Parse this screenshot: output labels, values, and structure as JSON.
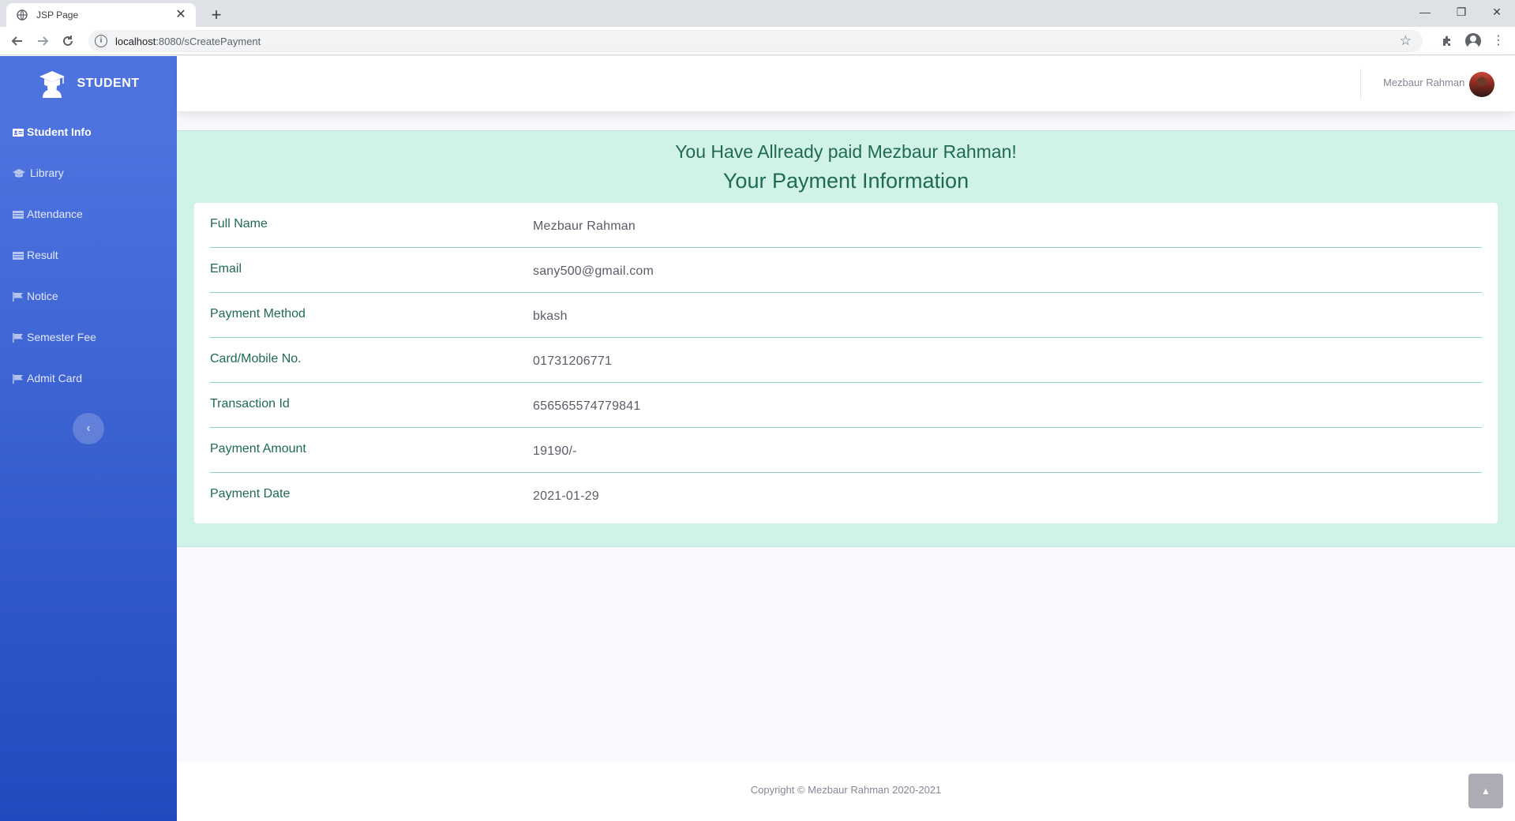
{
  "browser": {
    "tab_title": "JSP Page",
    "tab_close": "✕",
    "new_tab": "+",
    "url_host": "localhost",
    "url_path": ":8080/sCreatePayment",
    "window_controls": {
      "minimize": "—",
      "restore": "❐",
      "close": "✕"
    }
  },
  "sidebar": {
    "brand": "STUDENT",
    "items": [
      {
        "label": "Student Info",
        "icon": "id-card-icon",
        "active": true
      },
      {
        "label": "Library",
        "icon": "graduation-cap-icon"
      },
      {
        "label": "Attendance",
        "icon": "table-icon"
      },
      {
        "label": "Result",
        "icon": "table-icon"
      },
      {
        "label": "Notice",
        "icon": "flag-icon"
      },
      {
        "label": "Semester Fee",
        "icon": "flag-icon"
      },
      {
        "label": "Admit Card",
        "icon": "flag-icon"
      }
    ],
    "toggle_glyph": "‹"
  },
  "topbar": {
    "user_name": "Mezbaur Rahman"
  },
  "alert": {
    "title": "You Have Allready paid Mezbaur Rahman!",
    "subtitle": "Your Payment Information"
  },
  "payment": {
    "rows": [
      {
        "label": "Full Name",
        "value": "Mezbaur Rahman"
      },
      {
        "label": "Email",
        "value": "sany500@gmail.com"
      },
      {
        "label": "Payment Method",
        "value": "bkash"
      },
      {
        "label": "Card/Mobile No.",
        "value": "01731206771"
      },
      {
        "label": "Transaction Id",
        "value": "656565574779841"
      },
      {
        "label": "Payment Amount",
        "value": "19190/-"
      },
      {
        "label": "Payment Date",
        "value": "2021-01-29"
      }
    ]
  },
  "footer": {
    "copyright": "Copyright © Mezbaur Rahman 2020-2021"
  },
  "scroll_top_glyph": "▲",
  "colors": {
    "sidebar_top": "#4e73df",
    "sidebar_bottom": "#224abe",
    "success_bg": "#d1f2e8",
    "success_text": "#1f6b4d"
  }
}
